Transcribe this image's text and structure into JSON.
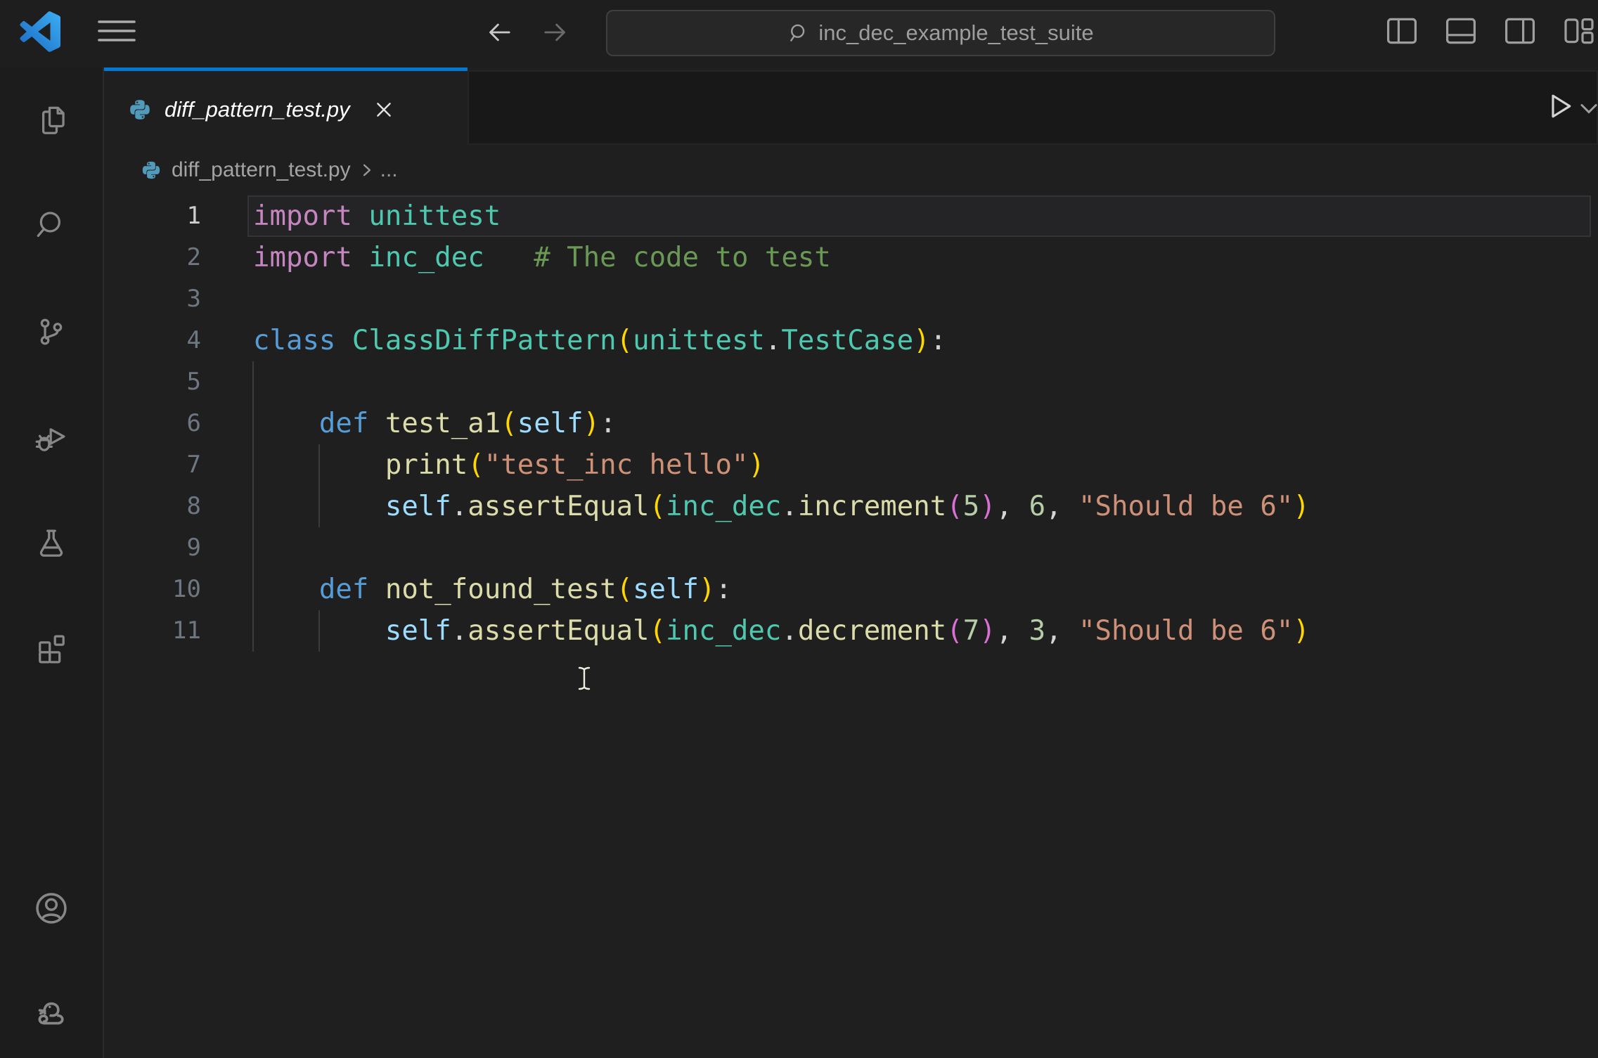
{
  "colors": {
    "pl": "#d4d4d4",
    "kw": "#c586c0",
    "st": "#569cd6",
    "ty": "#4ec9b0",
    "fn": "#dcdcaa",
    "va": "#9cdcfe",
    "str": "#ce9178",
    "num": "#b5cea8",
    "cm": "#6a9955",
    "b1": "#ffd700",
    "b2": "#da70d6",
    "accent": "#0078d4",
    "python_icon": "#519aba",
    "ui_icon": "#9a9a9a"
  },
  "title_bar": {
    "logo_icon": "vscode-logo",
    "menu_icon": "hamburger-menu",
    "back_icon": "arrow-left",
    "forward_icon": "arrow-right",
    "search_icon": "magnifier",
    "search_value": "inc_dec_example_test_suite",
    "layout_controls": [
      "toggle-primary-sidebar",
      "toggle-panel",
      "toggle-secondary-sidebar",
      "customize-layout"
    ]
  },
  "activity_bar": {
    "top_items": [
      "explorer",
      "search",
      "source-control",
      "run-and-debug",
      "testing",
      "extensions"
    ],
    "bottom_items": [
      "accounts",
      "python-environments"
    ]
  },
  "tab": {
    "label": "diff_pattern_test.py",
    "icon": "python-file-icon",
    "close_icon": "close-x",
    "preview_italic": true
  },
  "editor_actions": [
    "run-python-file",
    "run-options-dropdown"
  ],
  "breadcrumb": {
    "icon": "python-file-icon",
    "file": "diff_pattern_test.py",
    "separator_icon": "chevron-right",
    "ellipsis": "..."
  },
  "code": {
    "language": "python",
    "lines": [
      {
        "n": 1,
        "active": true,
        "guides": [],
        "tokens": [
          {
            "t": "import",
            "c": "kw"
          },
          {
            "t": " ",
            "c": "pl"
          },
          {
            "t": "unittest",
            "c": "ty"
          }
        ]
      },
      {
        "n": 2,
        "guides": [],
        "tokens": [
          {
            "t": "import",
            "c": "kw"
          },
          {
            "t": " ",
            "c": "pl"
          },
          {
            "t": "inc_dec",
            "c": "ty"
          },
          {
            "t": "   ",
            "c": "pl"
          },
          {
            "t": "# The code to test",
            "c": "cm"
          }
        ]
      },
      {
        "n": 3,
        "guides": [],
        "tokens": []
      },
      {
        "n": 4,
        "guides": [],
        "tokens": [
          {
            "t": "class",
            "c": "st"
          },
          {
            "t": " ",
            "c": "pl"
          },
          {
            "t": "ClassDiffPattern",
            "c": "ty"
          },
          {
            "t": "(",
            "c": "b1"
          },
          {
            "t": "unittest",
            "c": "ty"
          },
          {
            "t": ".",
            "c": "pl"
          },
          {
            "t": "TestCase",
            "c": "ty"
          },
          {
            "t": ")",
            "c": "b1"
          },
          {
            "t": ":",
            "c": "pl"
          }
        ]
      },
      {
        "n": 5,
        "guides": [
          0
        ],
        "tokens": []
      },
      {
        "n": 6,
        "guides": [
          0
        ],
        "tokens": [
          {
            "t": "    ",
            "c": "pl"
          },
          {
            "t": "def",
            "c": "st"
          },
          {
            "t": " ",
            "c": "pl"
          },
          {
            "t": "test_a1",
            "c": "fn"
          },
          {
            "t": "(",
            "c": "b1"
          },
          {
            "t": "self",
            "c": "va"
          },
          {
            "t": ")",
            "c": "b1"
          },
          {
            "t": ":",
            "c": "pl"
          }
        ]
      },
      {
        "n": 7,
        "guides": [
          0,
          4
        ],
        "tokens": [
          {
            "t": "        ",
            "c": "pl"
          },
          {
            "t": "print",
            "c": "fn"
          },
          {
            "t": "(",
            "c": "b1"
          },
          {
            "t": "\"test_inc hello\"",
            "c": "str"
          },
          {
            "t": ")",
            "c": "b1"
          }
        ]
      },
      {
        "n": 8,
        "guides": [
          0,
          4
        ],
        "tokens": [
          {
            "t": "        ",
            "c": "pl"
          },
          {
            "t": "self",
            "c": "va"
          },
          {
            "t": ".",
            "c": "pl"
          },
          {
            "t": "assertEqual",
            "c": "fn"
          },
          {
            "t": "(",
            "c": "b1"
          },
          {
            "t": "inc_dec",
            "c": "ty"
          },
          {
            "t": ".",
            "c": "pl"
          },
          {
            "t": "increment",
            "c": "fn"
          },
          {
            "t": "(",
            "c": "b2"
          },
          {
            "t": "5",
            "c": "num"
          },
          {
            "t": ")",
            "c": "b2"
          },
          {
            "t": ", ",
            "c": "pl"
          },
          {
            "t": "6",
            "c": "num"
          },
          {
            "t": ", ",
            "c": "pl"
          },
          {
            "t": "\"Should be 6\"",
            "c": "str"
          },
          {
            "t": ")",
            "c": "b1"
          }
        ]
      },
      {
        "n": 9,
        "guides": [
          0
        ],
        "tokens": []
      },
      {
        "n": 10,
        "guides": [
          0
        ],
        "tokens": [
          {
            "t": "    ",
            "c": "pl"
          },
          {
            "t": "def",
            "c": "st"
          },
          {
            "t": " ",
            "c": "pl"
          },
          {
            "t": "not_found_test",
            "c": "fn"
          },
          {
            "t": "(",
            "c": "b1"
          },
          {
            "t": "self",
            "c": "va"
          },
          {
            "t": ")",
            "c": "b1"
          },
          {
            "t": ":",
            "c": "pl"
          }
        ]
      },
      {
        "n": 11,
        "guides": [
          0,
          4
        ],
        "tokens": [
          {
            "t": "        ",
            "c": "pl"
          },
          {
            "t": "self",
            "c": "va"
          },
          {
            "t": ".",
            "c": "pl"
          },
          {
            "t": "assertEqual",
            "c": "fn"
          },
          {
            "t": "(",
            "c": "b1"
          },
          {
            "t": "inc_dec",
            "c": "ty"
          },
          {
            "t": ".",
            "c": "pl"
          },
          {
            "t": "decrement",
            "c": "fn"
          },
          {
            "t": "(",
            "c": "b2"
          },
          {
            "t": "7",
            "c": "num"
          },
          {
            "t": ")",
            "c": "b2"
          },
          {
            "t": ", ",
            "c": "pl"
          },
          {
            "t": "3",
            "c": "num"
          },
          {
            "t": ", ",
            "c": "pl"
          },
          {
            "t": "\"Should be 6\"",
            "c": "str"
          },
          {
            "t": ")",
            "c": "b1"
          }
        ]
      }
    ]
  }
}
